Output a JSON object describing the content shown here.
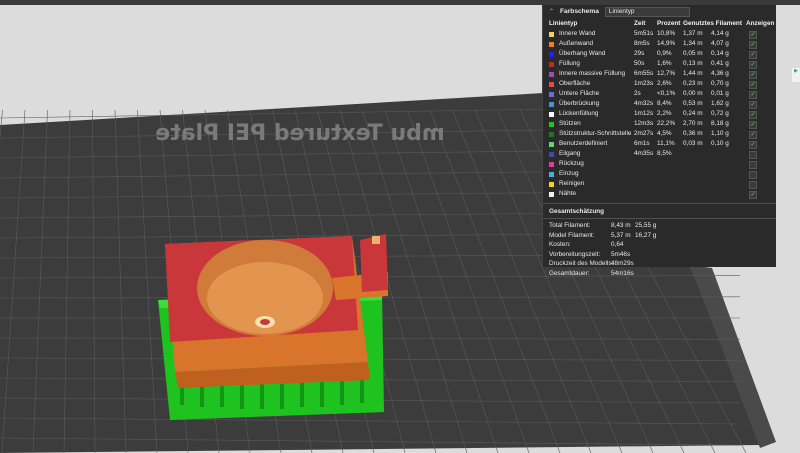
{
  "plate_label": "mbu Textured PEI Plate",
  "legend": {
    "title": "Farbschema",
    "selector_value": "Linientyp",
    "columns": {
      "type": "Linientyp",
      "time": "Zeit",
      "percent": "Prozent",
      "filament": "Genutztes Filament",
      "show": "Anzeigen"
    },
    "rows": [
      {
        "name": "Innere Wand",
        "time": "5m51s",
        "percent": "10,8%",
        "meters": "1,37 m",
        "grams": "4,14 g",
        "color": "#f3d25a",
        "checked": true
      },
      {
        "name": "Außenwand",
        "time": "8m5s",
        "percent": "14,9%",
        "meters": "1,34 m",
        "grams": "4,07 g",
        "color": "#f07c2c",
        "checked": true
      },
      {
        "name": "Überhang Wand",
        "time": "29s",
        "percent": "0,9%",
        "meters": "0,05 m",
        "grams": "0,14 g",
        "color": "#2020ff",
        "checked": true
      },
      {
        "name": "Füllung",
        "time": "50s",
        "percent": "1,6%",
        "meters": "0,13 m",
        "grams": "0,41 g",
        "color": "#b03029",
        "checked": true
      },
      {
        "name": "Innere massive Füllung",
        "time": "6m55s",
        "percent": "12,7%",
        "meters": "1,44 m",
        "grams": "4,36 g",
        "color": "#9a4fa8",
        "checked": true
      },
      {
        "name": "Oberfläche",
        "time": "1m23s",
        "percent": "2,6%",
        "meters": "0,23 m",
        "grams": "0,70 g",
        "color": "#e04a4a",
        "checked": true
      },
      {
        "name": "Untere Fläche",
        "time": "2s",
        "percent": "<0,1%",
        "meters": "0,00 m",
        "grams": "0,01 g",
        "color": "#6a6fd8",
        "checked": true
      },
      {
        "name": "Überbrückung",
        "time": "4m32s",
        "percent": "8,4%",
        "meters": "0,53 m",
        "grams": "1,62 g",
        "color": "#4a8fd8",
        "checked": true
      },
      {
        "name": "Lückenfüllung",
        "time": "1m12s",
        "percent": "2,2%",
        "meters": "0,24 m",
        "grams": "0,72 g",
        "color": "#ffffff",
        "checked": true
      },
      {
        "name": "Stützen",
        "time": "12m3s",
        "percent": "22,2%",
        "meters": "2,70 m",
        "grams": "8,18 g",
        "color": "#22c322",
        "checked": true
      },
      {
        "name": "Stützstruktur-Schnittstelle",
        "time": "2m27s",
        "percent": "4,5%",
        "meters": "0,36 m",
        "grams": "1,10 g",
        "color": "#1a7a1a",
        "checked": true
      },
      {
        "name": "Benutzerdefiniert",
        "time": "6m1s",
        "percent": "11,1%",
        "meters": "0,03 m",
        "grams": "0,10 g",
        "color": "#5ad878",
        "checked": true
      },
      {
        "name": "Eilgang",
        "time": "4m35s",
        "percent": "8,5%",
        "meters": "",
        "grams": "",
        "color": "#3a4ab0",
        "checked": false
      },
      {
        "name": "Rückzug",
        "time": "",
        "percent": "",
        "meters": "",
        "grams": "",
        "color": "#e03aa0",
        "checked": false
      },
      {
        "name": "Einzug",
        "time": "",
        "percent": "",
        "meters": "",
        "grams": "",
        "color": "#46b0d8",
        "checked": false
      },
      {
        "name": "Reinigen",
        "time": "",
        "percent": "",
        "meters": "",
        "grams": "",
        "color": "#f0d020",
        "checked": false
      },
      {
        "name": "Nähte",
        "time": "",
        "percent": "",
        "meters": "",
        "grams": "",
        "color": "#f0f0f0",
        "checked": true
      }
    ]
  },
  "summary": {
    "title": "Gesamtschätzung",
    "rows": [
      {
        "label": "Total Filament:",
        "v1": "8,43 m",
        "v2": "25,55 g"
      },
      {
        "label": "Model Filament:",
        "v1": "5,37 m",
        "v2": "16,27 g"
      },
      {
        "label": "Kosten:",
        "v1": "0,64",
        "v2": ""
      },
      {
        "label": "Vorbereitungszeit:",
        "v1": "5m46s",
        "v2": ""
      },
      {
        "label": "Druckzeit des Modells:",
        "v1": "48m29s",
        "v2": ""
      },
      {
        "label": "Gesamtdauer:",
        "v1": "54m16s",
        "v2": ""
      }
    ]
  }
}
